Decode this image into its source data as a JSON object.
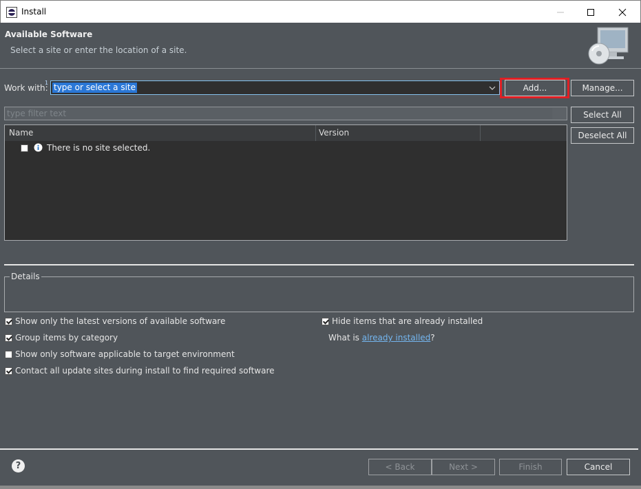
{
  "window": {
    "title": "Install"
  },
  "header": {
    "title": "Available Software",
    "subtitle": "Select a site or enter the location of a site."
  },
  "work_with": {
    "label": "Work with:",
    "marker": "1",
    "value": "type or select a site"
  },
  "buttons": {
    "add": "Add...",
    "manage": "Manage...",
    "select_all": "Select All",
    "deselect_all": "Deselect All",
    "back": "< Back",
    "next": "Next >",
    "finish": "Finish",
    "cancel": "Cancel"
  },
  "filter": {
    "placeholder": "type filter text"
  },
  "table": {
    "columns": [
      "Name",
      "Version"
    ],
    "rows": [
      {
        "text": "There is no site selected."
      }
    ]
  },
  "details": {
    "legend": "Details"
  },
  "options": [
    {
      "label": "Show only the latest versions of available software",
      "checked": true
    },
    {
      "label": "Group items by category",
      "checked": true
    },
    {
      "label": "Show only software applicable to target environment",
      "checked": false
    },
    {
      "label": "Contact all update sites during install to find required software",
      "checked": true
    }
  ],
  "hide_installed": {
    "label": "Hide items that are already installed",
    "checked": true
  },
  "what_is": {
    "prefix": "What is ",
    "link": "already installed",
    "suffix": "?"
  },
  "colors": {
    "background": "#50555a",
    "highlight": "#e01f24",
    "link": "#74b6f0",
    "selection": "#2a77d6"
  },
  "icons": [
    "eclipse-icon",
    "minimize-icon",
    "maximize-icon",
    "close-icon",
    "monitor-cd-icon",
    "dropdown-arrow-icon",
    "info-icon",
    "help-icon"
  ]
}
